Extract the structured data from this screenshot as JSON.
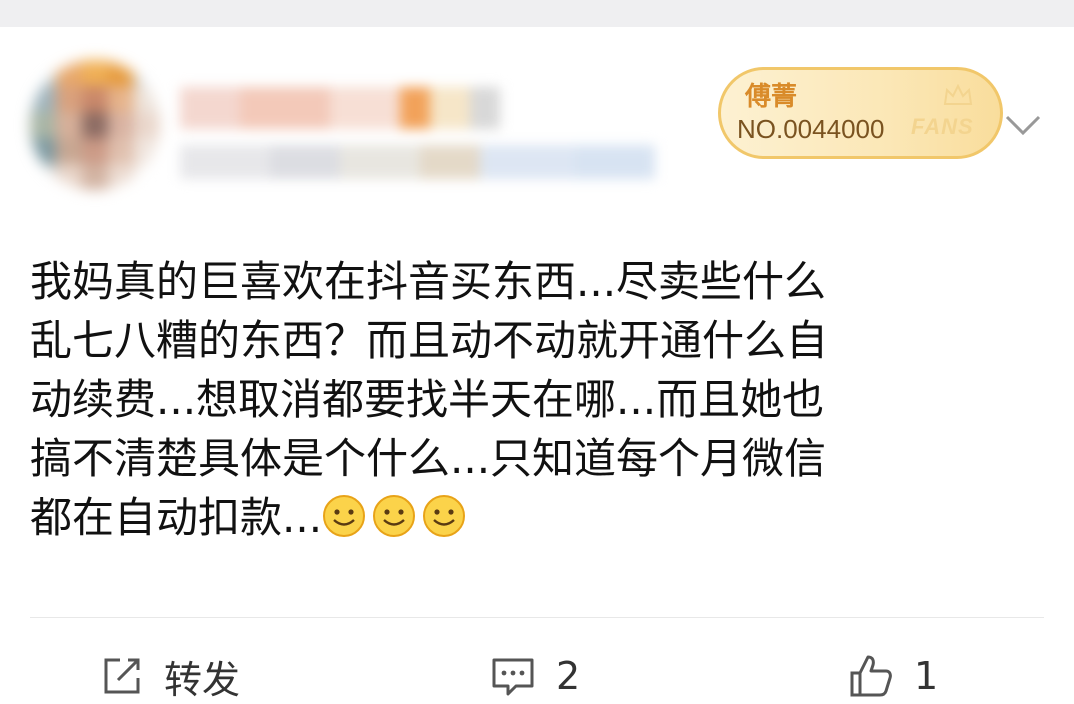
{
  "fans_badge": {
    "name": "傅菁",
    "number": "NO.0044000",
    "word": "FANS"
  },
  "post": {
    "lines": [
      "我妈真的巨喜欢在抖音买东西...尽卖些什么",
      "乱七八糟的东西？而且动不动就开通什么自",
      "动续费...想取消都要找半天在哪...而且她也",
      "搞不清楚具体是个什么...只知道每个月微信",
      "都在自动扣款..."
    ],
    "emoji": [
      "smile-emoji",
      "smile-emoji",
      "smile-emoji"
    ]
  },
  "actions": {
    "repost_label": "转发",
    "comment_count": "2",
    "like_count": "1"
  },
  "colors": {
    "badge_accent": "#d98b2a",
    "text": "#111111",
    "action_gray": "#333333"
  }
}
